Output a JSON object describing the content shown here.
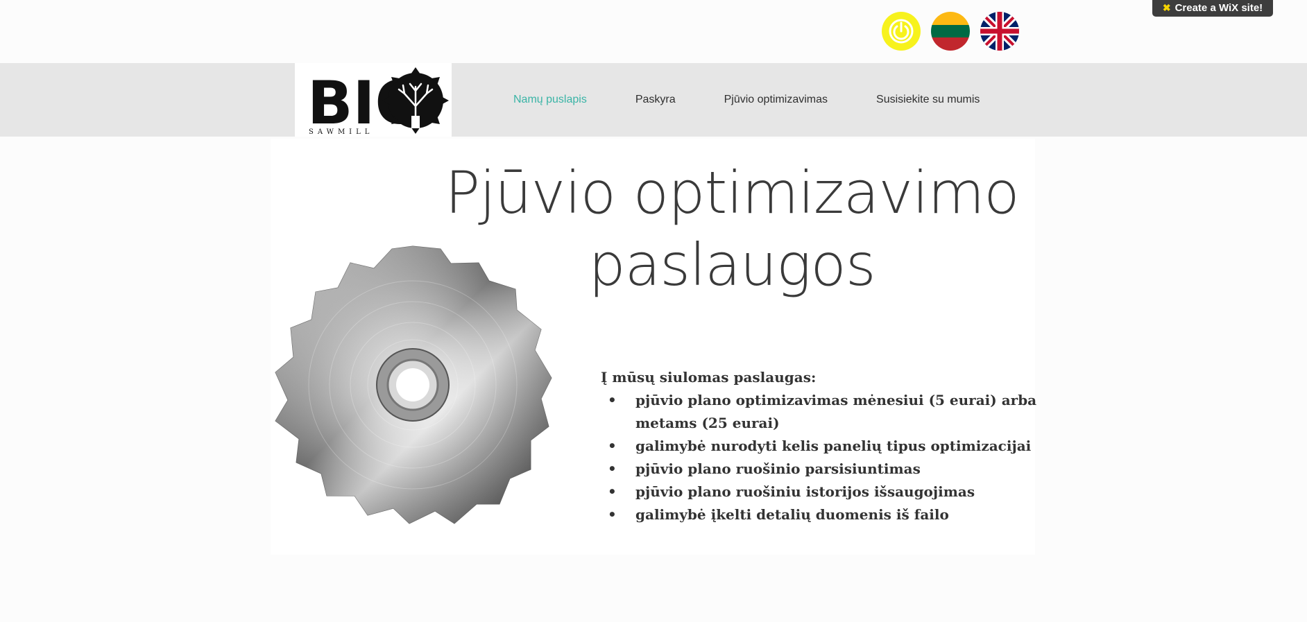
{
  "wix_badge": {
    "label": "Create a WiX site!"
  },
  "top_icons": {
    "power": "power-icon",
    "lt_flag": "lithuania-flag-icon",
    "uk_flag": "uk-flag-icon"
  },
  "logo": {
    "text": "BIO",
    "subtext": "SAWMILL"
  },
  "nav": {
    "items": [
      {
        "label": "Namų puslapis",
        "active": true
      },
      {
        "label": "Paskyra"
      },
      {
        "label": "Pjūvio optimizavimas"
      },
      {
        "label": "Susisiekite su mumis"
      }
    ]
  },
  "main": {
    "title_line1": "Pjūvio optimizavimo",
    "title_line2": "paslaugos",
    "services_intro": "Į mūsų siulomas paslaugas:",
    "services": [
      "pjūvio plano optimizavimas mėnesiui (5 eurai) arba metams (25 eurai)",
      "galimybė nurodyti kelis panelių tipus optimizacijai",
      "pjūvio plano ruošinio parsisiuntimas",
      "pjūvio plano ruošiniu istorijos išsaugojimas",
      "galimybė įkelti detalių duomenis iš failo"
    ]
  },
  "colors": {
    "header_bg": "#e6e6e6",
    "nav_active": "#3ab4a6",
    "power_yellow": "#f7f21d"
  }
}
